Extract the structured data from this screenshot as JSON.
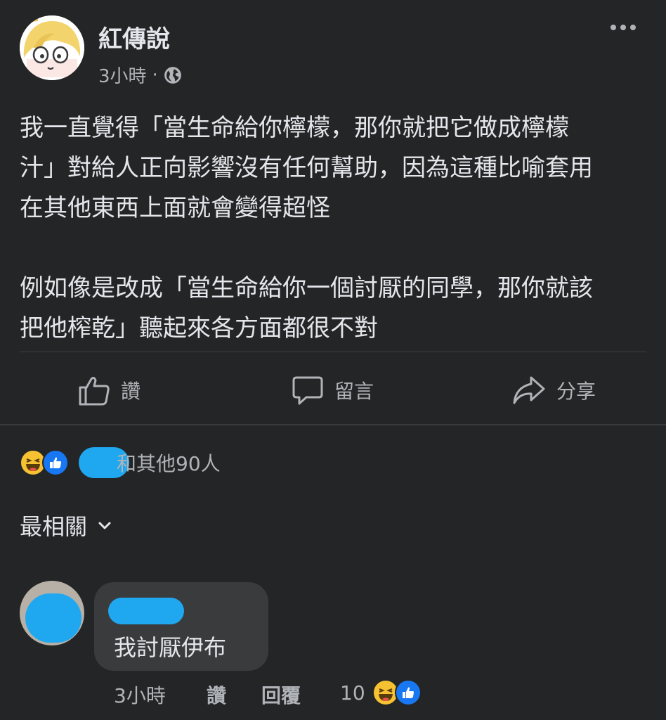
{
  "post": {
    "author": "紅傳說",
    "time": "3小時",
    "separator": "·",
    "visibility_icon": "globe-icon",
    "lines": [
      "我一直覺得「當生命給你檸檬，那你就把它做成檸檬",
      "汁」對給人正向影響沒有任何幫助，因為這種比喻套用",
      "在其他東西上面就會變得超怪",
      "例如像是改成「當生命給你一個討厭的同學，那你就該",
      "把他榨乾」聽起來各方面都很不對"
    ]
  },
  "actions": {
    "like": "讚",
    "comment": "留言",
    "share": "分享"
  },
  "reactions": {
    "summary": "和其他90人"
  },
  "comments_section": {
    "sort_label": "最相關"
  },
  "comment": {
    "text": "我討厭伊布",
    "time": "3小時",
    "like": "讚",
    "reply": "回覆",
    "reaction_count": "10"
  },
  "colors": {
    "background": "#242526",
    "text": "#e4e6eb",
    "secondary_text": "#b0b3b8",
    "like_blue": "#1877f2",
    "haha_yellow": "#f7c232",
    "redaction_blue": "#1fa8f0"
  }
}
